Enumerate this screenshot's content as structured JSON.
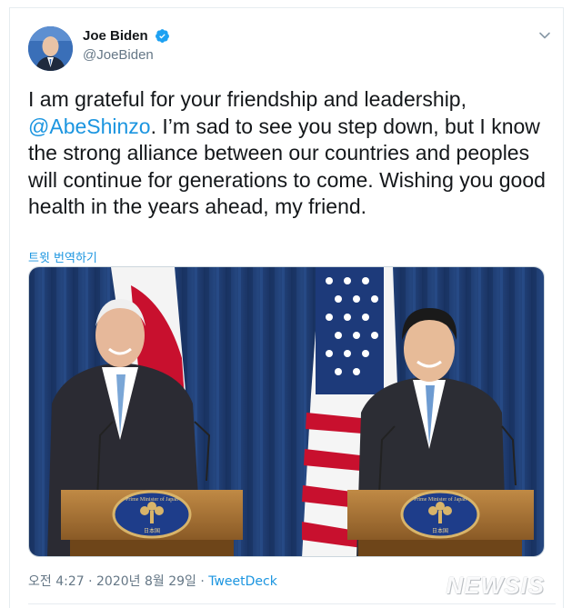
{
  "tweet": {
    "display_name": "Joe Biden",
    "handle": "@JoeBiden",
    "text_before_mention": "I am grateful for your friendship and leadership, ",
    "mention": "@AbeShinzo",
    "text_after_mention": ". I’m sad to see you step down, but I know the strong alliance between our countries and peoples will continue for generations to come. Wishing you good health in the years ahead, my friend.",
    "translate_label": "트윗 번역하기",
    "timestamp": "오전 4:27 · 2020년 8월 29일",
    "separator": " · ",
    "source": "TweetDeck"
  },
  "media": {
    "podium_seal_text": "Prime Minister of Japan",
    "podium_seal_sub": "日本国"
  },
  "watermark": {
    "text": "NEWSIS"
  },
  "colors": {
    "link": "#1b95e0",
    "verified": "#1da1f2",
    "curtain": "#1e3a6e",
    "podium": "#b07a3a"
  },
  "icons": {
    "verified": "verified-badge-icon",
    "caret": "chevron-down-icon"
  }
}
